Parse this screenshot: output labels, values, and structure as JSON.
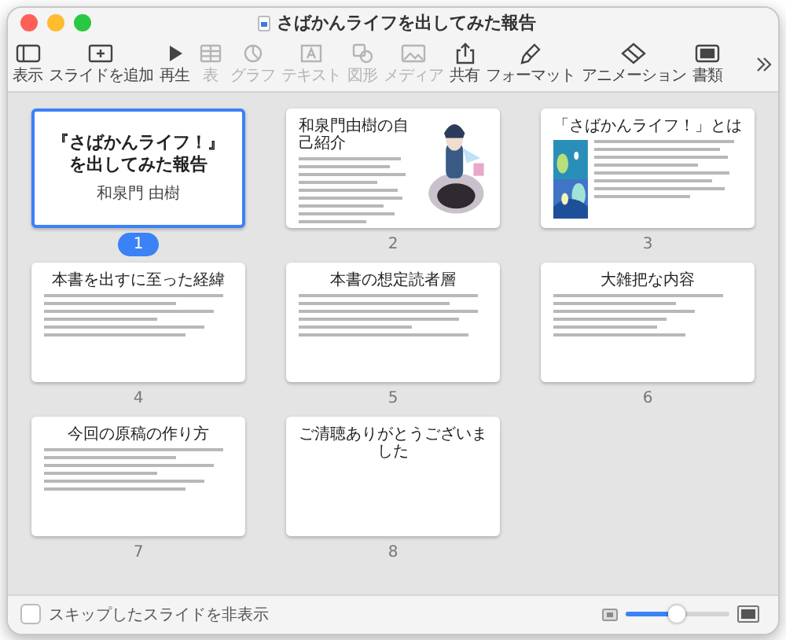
{
  "window": {
    "title": "さばかんライフを出してみた報告"
  },
  "toolbar": {
    "items": [
      {
        "label": "表示",
        "disabled": false
      },
      {
        "label": "スライドを追加",
        "disabled": false
      },
      {
        "label": "再生",
        "disabled": false
      },
      {
        "label": "表",
        "disabled": true
      },
      {
        "label": "グラフ",
        "disabled": true
      },
      {
        "label": "テキスト",
        "disabled": true
      },
      {
        "label": "図形",
        "disabled": true
      },
      {
        "label": "メディア",
        "disabled": true
      },
      {
        "label": "共有",
        "disabled": false
      },
      {
        "label": "フォーマット",
        "disabled": false
      },
      {
        "label": "アニメーション",
        "disabled": false
      },
      {
        "label": "書類",
        "disabled": false
      }
    ]
  },
  "slides": [
    {
      "number": "1",
      "selected": true,
      "kind": "title",
      "title_lines": [
        "『さばかんライフ！』",
        "を出してみた報告"
      ],
      "author": "和泉門 由樹"
    },
    {
      "number": "2",
      "selected": false,
      "kind": "text-picture",
      "title": "和泉門由樹の自己紹介"
    },
    {
      "number": "3",
      "selected": false,
      "kind": "picture-text",
      "title": "「さばかんライフ！」とは"
    },
    {
      "number": "4",
      "selected": false,
      "kind": "list",
      "title": "本書を出すに至った経緯"
    },
    {
      "number": "5",
      "selected": false,
      "kind": "paragraphs",
      "title": "本書の想定読者層"
    },
    {
      "number": "6",
      "selected": false,
      "kind": "lines",
      "title": "大雑把な内容"
    },
    {
      "number": "7",
      "selected": false,
      "kind": "list",
      "title": "今回の原稿の作り方"
    },
    {
      "number": "8",
      "selected": false,
      "kind": "empty",
      "title": "ご清聴ありがとうございました"
    }
  ],
  "footer": {
    "checkbox": {
      "label": "スキップしたスライドを非表示",
      "checked": false
    },
    "zoom": {
      "level": 0.5
    }
  }
}
